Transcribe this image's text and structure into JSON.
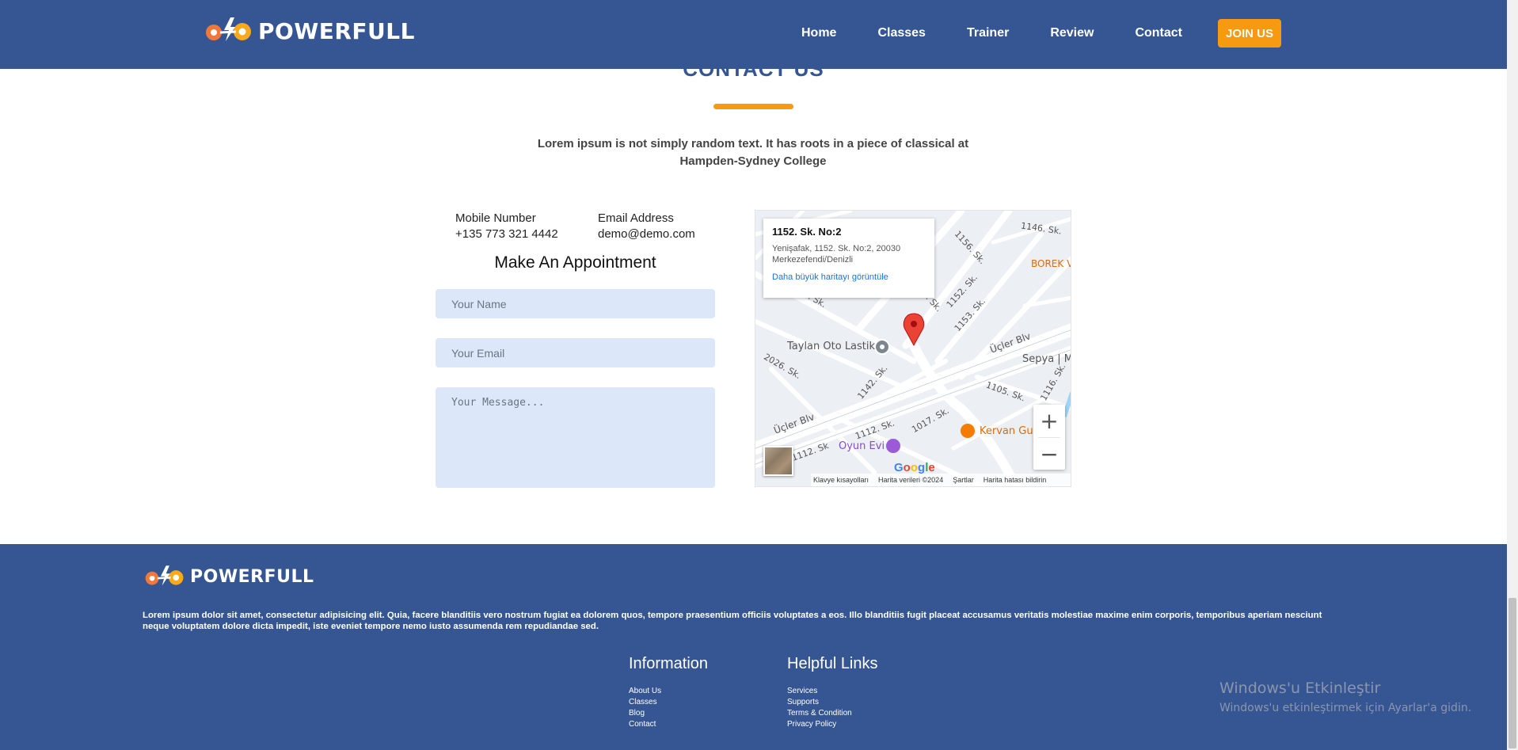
{
  "brand": {
    "name": "POWERFULL"
  },
  "nav": {
    "items": [
      "Home",
      "Classes",
      "Trainer",
      "Review",
      "Contact"
    ],
    "cta": "JOIN US"
  },
  "colors": {
    "primary": "#355693",
    "accent": "#f79a11",
    "field_bg": "#dce8f9"
  },
  "contact": {
    "title": "CONTACT US",
    "intro": "Lorem ipsum is not simply random text. It has roots in a piece of classical at Hampden-Sydney College",
    "mobile_label": "Mobile Number",
    "mobile_value": "+135 773 321 4442",
    "email_label": "Email Address",
    "email_value": "demo@demo.com",
    "form_title": "Make An Appointment",
    "name_placeholder": "Your Name",
    "email_placeholder": "Your Email",
    "message_placeholder": "Your Message..."
  },
  "map": {
    "card_title": "1152. Sk. No:2",
    "card_address": "Yenişafak, 1152. Sk. No:2, 20030 Merkezefendi/Denizli",
    "card_link": "Daha büyük haritayı görüntüle",
    "labels": [
      "1146. Sk.",
      "1156. Sk.",
      "BOREK V",
      "2030. Sk.",
      "1154. Sk.",
      "1152. Sk.",
      "1153. Sk.",
      "Taylan Oto Lastik",
      "Üçler Blv",
      "Sepya | Me",
      "2026. Sk.",
      "1142. Sk.",
      "1105. Sk.",
      "1116. Sk.",
      "1112. Sk.",
      "1017. Sk.",
      "Kervan Gu",
      "Oyun Evi",
      "Üçler Blv",
      "1112. Sk"
    ],
    "footer": [
      "Klavye kısayolları",
      "Harita verileri ©2024",
      "Şartlar",
      "Harita hatası bildirin"
    ],
    "google": "Google",
    "zoom_in": "+",
    "zoom_out": "−"
  },
  "footer": {
    "description": "Lorem ipsum dolor sit amet, consectetur adipisicing elit. Quia, facere blanditiis vero nostrum fugiat ea dolorem quos, tempore praesentium officiis voluptates a eos. Illo blanditiis fugit placeat accusamus veritatis molestiae maxime enim corporis, temporibus aperiam nesciunt neque voluptatem dolore dicta impedit, iste eveniet tempore nemo iusto assumenda rem repudiandae sed.",
    "info_title": "Information",
    "info_links": [
      "About Us",
      "Classes",
      "Blog",
      "Contact"
    ],
    "help_title": "Helpful Links",
    "help_links": [
      "Services",
      "Supports",
      "Terms & Condition",
      "Privacy Policy"
    ]
  },
  "watermark": {
    "title": "Windows'u Etkinleştir",
    "subtitle": "Windows'u etkinleştirmek için Ayarlar'a gidin."
  }
}
